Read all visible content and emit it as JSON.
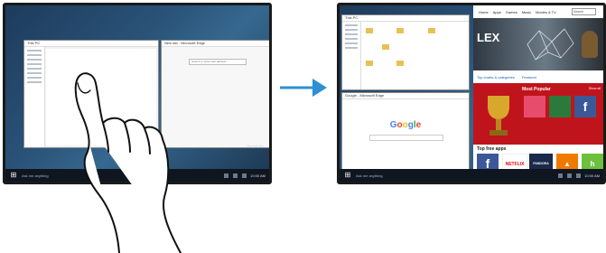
{
  "left_screen": {
    "explorer_title": "This PC",
    "edge_title": "New tab - Microsoft Edge",
    "edge_search_placeholder": "Search or enter web address",
    "recycle_label": "Recycle Bin",
    "taskbar_search": "Ask me anything",
    "clock": "10:00 AM"
  },
  "right_screen": {
    "explorer_title": "This PC",
    "edge_title": "Google - Microsoft Edge",
    "google_logo": "Google",
    "store_nav": [
      "Home",
      "Apps",
      "Games",
      "Music",
      "Movies & TV"
    ],
    "store_search": "Search",
    "hero_text": "LEX",
    "top_charts": "Top charts & categories",
    "featured": "Featured",
    "most_popular": "Most Popular",
    "show_all": "Show all",
    "top_free_apps": "Top free apps",
    "apps": [
      "NETFLIX",
      "PANDORA"
    ],
    "taskbar_search": "Ask me anything",
    "clock": "10:00 AM"
  },
  "colors": {
    "screen_bezel": "#1a1a1a",
    "desktop": "#2a5378",
    "arrow": "#2d8fd4",
    "store_red": "#c0141c"
  }
}
